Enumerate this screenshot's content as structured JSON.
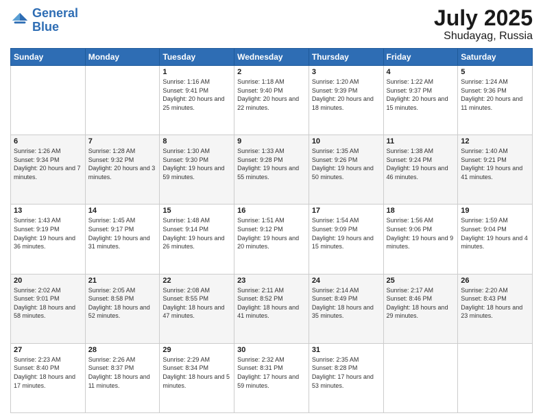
{
  "header": {
    "logo_line1": "General",
    "logo_line2": "Blue",
    "month": "July 2025",
    "location": "Shudayag, Russia"
  },
  "weekdays": [
    "Sunday",
    "Monday",
    "Tuesday",
    "Wednesday",
    "Thursday",
    "Friday",
    "Saturday"
  ],
  "weeks": [
    [
      {
        "day": "",
        "sunrise": "",
        "sunset": "",
        "daylight": ""
      },
      {
        "day": "",
        "sunrise": "",
        "sunset": "",
        "daylight": ""
      },
      {
        "day": "1",
        "sunrise": "Sunrise: 1:16 AM",
        "sunset": "Sunset: 9:41 PM",
        "daylight": "Daylight: 20 hours and 25 minutes."
      },
      {
        "day": "2",
        "sunrise": "Sunrise: 1:18 AM",
        "sunset": "Sunset: 9:40 PM",
        "daylight": "Daylight: 20 hours and 22 minutes."
      },
      {
        "day": "3",
        "sunrise": "Sunrise: 1:20 AM",
        "sunset": "Sunset: 9:39 PM",
        "daylight": "Daylight: 20 hours and 18 minutes."
      },
      {
        "day": "4",
        "sunrise": "Sunrise: 1:22 AM",
        "sunset": "Sunset: 9:37 PM",
        "daylight": "Daylight: 20 hours and 15 minutes."
      },
      {
        "day": "5",
        "sunrise": "Sunrise: 1:24 AM",
        "sunset": "Sunset: 9:36 PM",
        "daylight": "Daylight: 20 hours and 11 minutes."
      }
    ],
    [
      {
        "day": "6",
        "sunrise": "Sunrise: 1:26 AM",
        "sunset": "Sunset: 9:34 PM",
        "daylight": "Daylight: 20 hours and 7 minutes."
      },
      {
        "day": "7",
        "sunrise": "Sunrise: 1:28 AM",
        "sunset": "Sunset: 9:32 PM",
        "daylight": "Daylight: 20 hours and 3 minutes."
      },
      {
        "day": "8",
        "sunrise": "Sunrise: 1:30 AM",
        "sunset": "Sunset: 9:30 PM",
        "daylight": "Daylight: 19 hours and 59 minutes."
      },
      {
        "day": "9",
        "sunrise": "Sunrise: 1:33 AM",
        "sunset": "Sunset: 9:28 PM",
        "daylight": "Daylight: 19 hours and 55 minutes."
      },
      {
        "day": "10",
        "sunrise": "Sunrise: 1:35 AM",
        "sunset": "Sunset: 9:26 PM",
        "daylight": "Daylight: 19 hours and 50 minutes."
      },
      {
        "day": "11",
        "sunrise": "Sunrise: 1:38 AM",
        "sunset": "Sunset: 9:24 PM",
        "daylight": "Daylight: 19 hours and 46 minutes."
      },
      {
        "day": "12",
        "sunrise": "Sunrise: 1:40 AM",
        "sunset": "Sunset: 9:21 PM",
        "daylight": "Daylight: 19 hours and 41 minutes."
      }
    ],
    [
      {
        "day": "13",
        "sunrise": "Sunrise: 1:43 AM",
        "sunset": "Sunset: 9:19 PM",
        "daylight": "Daylight: 19 hours and 36 minutes."
      },
      {
        "day": "14",
        "sunrise": "Sunrise: 1:45 AM",
        "sunset": "Sunset: 9:17 PM",
        "daylight": "Daylight: 19 hours and 31 minutes."
      },
      {
        "day": "15",
        "sunrise": "Sunrise: 1:48 AM",
        "sunset": "Sunset: 9:14 PM",
        "daylight": "Daylight: 19 hours and 26 minutes."
      },
      {
        "day": "16",
        "sunrise": "Sunrise: 1:51 AM",
        "sunset": "Sunset: 9:12 PM",
        "daylight": "Daylight: 19 hours and 20 minutes."
      },
      {
        "day": "17",
        "sunrise": "Sunrise: 1:54 AM",
        "sunset": "Sunset: 9:09 PM",
        "daylight": "Daylight: 19 hours and 15 minutes."
      },
      {
        "day": "18",
        "sunrise": "Sunrise: 1:56 AM",
        "sunset": "Sunset: 9:06 PM",
        "daylight": "Daylight: 19 hours and 9 minutes."
      },
      {
        "day": "19",
        "sunrise": "Sunrise: 1:59 AM",
        "sunset": "Sunset: 9:04 PM",
        "daylight": "Daylight: 19 hours and 4 minutes."
      }
    ],
    [
      {
        "day": "20",
        "sunrise": "Sunrise: 2:02 AM",
        "sunset": "Sunset: 9:01 PM",
        "daylight": "Daylight: 18 hours and 58 minutes."
      },
      {
        "day": "21",
        "sunrise": "Sunrise: 2:05 AM",
        "sunset": "Sunset: 8:58 PM",
        "daylight": "Daylight: 18 hours and 52 minutes."
      },
      {
        "day": "22",
        "sunrise": "Sunrise: 2:08 AM",
        "sunset": "Sunset: 8:55 PM",
        "daylight": "Daylight: 18 hours and 47 minutes."
      },
      {
        "day": "23",
        "sunrise": "Sunrise: 2:11 AM",
        "sunset": "Sunset: 8:52 PM",
        "daylight": "Daylight: 18 hours and 41 minutes."
      },
      {
        "day": "24",
        "sunrise": "Sunrise: 2:14 AM",
        "sunset": "Sunset: 8:49 PM",
        "daylight": "Daylight: 18 hours and 35 minutes."
      },
      {
        "day": "25",
        "sunrise": "Sunrise: 2:17 AM",
        "sunset": "Sunset: 8:46 PM",
        "daylight": "Daylight: 18 hours and 29 minutes."
      },
      {
        "day": "26",
        "sunrise": "Sunrise: 2:20 AM",
        "sunset": "Sunset: 8:43 PM",
        "daylight": "Daylight: 18 hours and 23 minutes."
      }
    ],
    [
      {
        "day": "27",
        "sunrise": "Sunrise: 2:23 AM",
        "sunset": "Sunset: 8:40 PM",
        "daylight": "Daylight: 18 hours and 17 minutes."
      },
      {
        "day": "28",
        "sunrise": "Sunrise: 2:26 AM",
        "sunset": "Sunset: 8:37 PM",
        "daylight": "Daylight: 18 hours and 11 minutes."
      },
      {
        "day": "29",
        "sunrise": "Sunrise: 2:29 AM",
        "sunset": "Sunset: 8:34 PM",
        "daylight": "Daylight: 18 hours and 5 minutes."
      },
      {
        "day": "30",
        "sunrise": "Sunrise: 2:32 AM",
        "sunset": "Sunset: 8:31 PM",
        "daylight": "Daylight: 17 hours and 59 minutes."
      },
      {
        "day": "31",
        "sunrise": "Sunrise: 2:35 AM",
        "sunset": "Sunset: 8:28 PM",
        "daylight": "Daylight: 17 hours and 53 minutes."
      },
      {
        "day": "",
        "sunrise": "",
        "sunset": "",
        "daylight": ""
      },
      {
        "day": "",
        "sunrise": "",
        "sunset": "",
        "daylight": ""
      }
    ]
  ]
}
